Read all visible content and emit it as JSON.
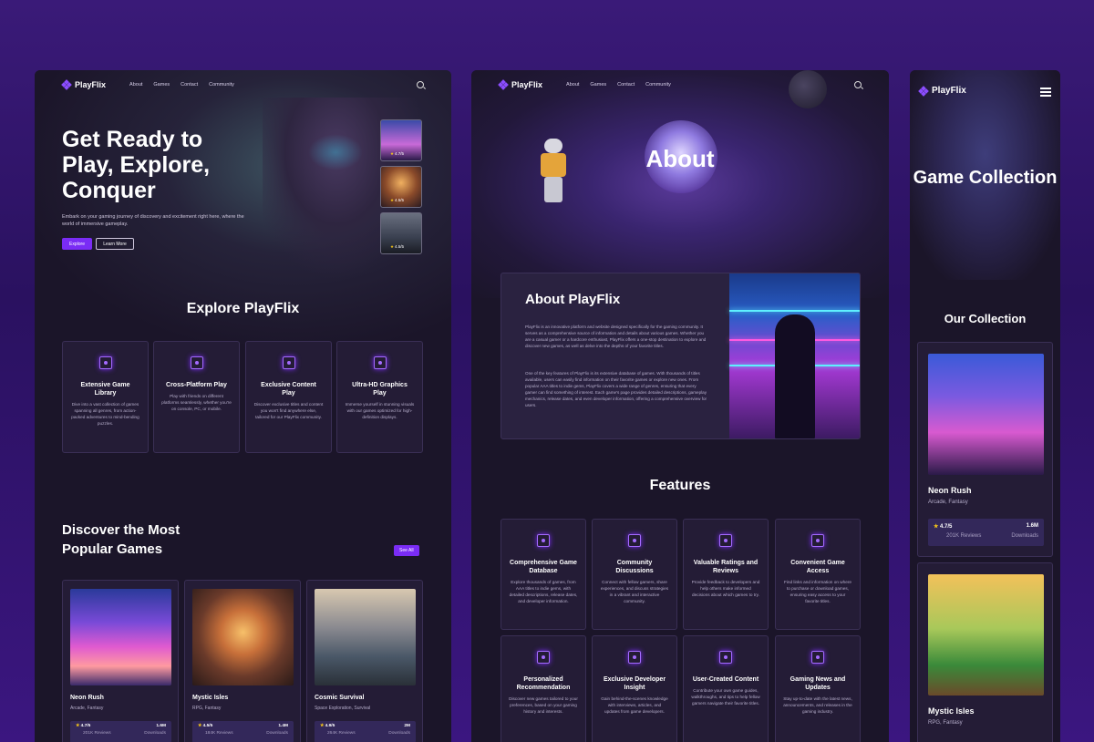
{
  "brand": "PlayFlix",
  "nav": [
    "About",
    "Games",
    "Contact",
    "Community"
  ],
  "home": {
    "hero_title": "Get Ready to Play, Explore, Conquer",
    "hero_sub": "Embark on your gaming journey of discovery and excitement right here, where the world of immersive gameplay.",
    "explore_btn": "Explore",
    "learn_btn": "Learn More",
    "thumb_ratings": [
      "4.7/5",
      "4.5/5",
      "4.5/5"
    ],
    "explore_title": "Explore PlayFlix",
    "features": [
      {
        "title": "Extensive Game Library",
        "desc": "Dive into a vast collection of games spanning all genres, from action-packed adventures to mind-bending puzzles."
      },
      {
        "title": "Cross-Platform Play",
        "desc": "Play with friends on different platforms seamlessly, whether you're on console, PC, or mobile."
      },
      {
        "title": "Exclusive Content Play",
        "desc": "Discover exclusive titles and content you won't find anywhere else, tailored for our PlayFlix community."
      },
      {
        "title": "Ultra-HD Graphics Play",
        "desc": "Immerse yourself in stunning visuals with our games optimized for high-definition displays."
      }
    ],
    "popular_title": "Discover the Most Popular Games",
    "see_all": "See All",
    "games": [
      {
        "name": "Neon Rush",
        "tags": "Arcade, Fantasy",
        "rating": "4.7/5",
        "reviews": "201K Reviews",
        "downloads": "1.6M",
        "downloads_label": "Downloads"
      },
      {
        "name": "Mystic Isles",
        "tags": "RPG, Fantasy",
        "rating": "4.5/5",
        "reviews": "184K Reviews",
        "downloads": "1.4M",
        "downloads_label": "Downloads"
      },
      {
        "name": "Cosmic Survival",
        "tags": "Space Exploration, Survival",
        "rating": "4.9/5",
        "reviews": "264K Reviews",
        "downloads": "2M",
        "downloads_label": "Downloads"
      }
    ]
  },
  "about": {
    "hero_title": "About",
    "box_title": "About PlayFlix",
    "p1": "PlayFlix is an innovative platform and website designed specifically for the gaming community. It serves as a comprehensive source of information and details about various games. Whether you are a casual gamer or a hardcore enthusiast, PlayFlix offers a one-stop destination to explore and discover new games, as well as delve into the depths of your favorite titles.",
    "p2": "One of the key features of PlayFlix is its extensive database of games. With thousands of titles available, users can easily find information on their favorite games or explore new ones. From popular AAA titles to indie gems, PlayFlix covers a wide range of genres, ensuring that every gamer can find something of interest. Each game's page provides detailed descriptions, gameplay mechanics, release dates, and even developer information, offering a comprehensive overview for users.",
    "features_title": "Features",
    "features": [
      {
        "title": "Comprehensive Game Database",
        "desc": "Explore thousands of games, from AAA titles to indie gems, with detailed descriptions, release dates, and developer information."
      },
      {
        "title": "Community Discussions",
        "desc": "Connect with fellow gamers, share experiences, and discuss strategies in a vibrant and interactive community."
      },
      {
        "title": "Valuable Ratings and Reviews",
        "desc": "Provide feedback to developers and help others make informed decisions about which games to try."
      },
      {
        "title": "Convenient Game Access",
        "desc": "Find links and information on where to purchase or download games, ensuring easy access to your favorite titles."
      },
      {
        "title": "Personalized Recommendation",
        "desc": "Discover new games tailored to your preferences, based on your gaming history and interests."
      },
      {
        "title": "Exclusive Developer Insight",
        "desc": "Gain behind-the-scenes knowledge with interviews, articles, and updates from game developers."
      },
      {
        "title": "User-Created Content",
        "desc": "Contribute your own game guides, walkthroughs, and tips to help fellow gamers navigate their favorite titles."
      },
      {
        "title": "Gaming News and Updates",
        "desc": "Stay up-to-date with the latest news, announcements, and releases in the gaming industry."
      }
    ]
  },
  "collection": {
    "hero_title": "Game Collection",
    "section_title": "Our Collection",
    "games": [
      {
        "name": "Neon Rush",
        "tags": "Arcade, Fantasy",
        "rating": "4.7/5",
        "reviews": "201K Reviews",
        "downloads": "1.6M",
        "downloads_label": "Downloads"
      },
      {
        "name": "Mystic Isles",
        "tags": "RPG, Fantasy"
      }
    ]
  }
}
